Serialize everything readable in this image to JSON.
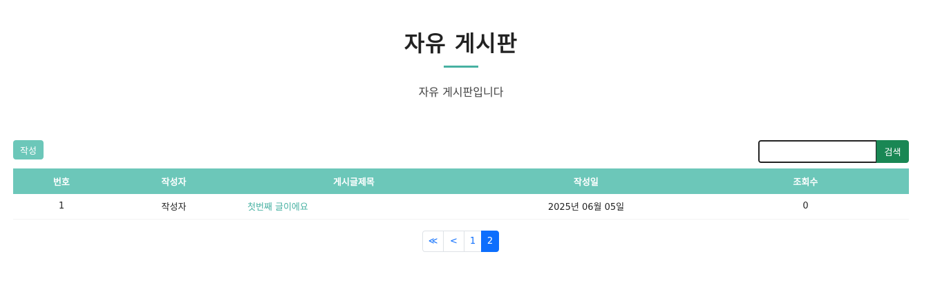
{
  "header": {
    "title": "자유 게시판",
    "subtitle": "자유 게시판입니다"
  },
  "toolbar": {
    "write_label": "작성",
    "search_value": "",
    "search_label": "검색"
  },
  "table": {
    "columns": [
      "번호",
      "작성자",
      "게시글제목",
      "작성일",
      "조회수"
    ],
    "rows": [
      {
        "no": "1",
        "author": "작성자",
        "title": "첫번째 글이에요",
        "date": "2025년 06월 05일",
        "views": "0"
      }
    ]
  },
  "pagination": {
    "first_label": "≪",
    "prev_label": "<",
    "pages": [
      "1",
      "2"
    ],
    "current_page": "2"
  },
  "colors": {
    "accent": "#6cc7b9",
    "link": "#47b1a2",
    "search_button": "#198754",
    "page_active": "#0d6efd"
  }
}
